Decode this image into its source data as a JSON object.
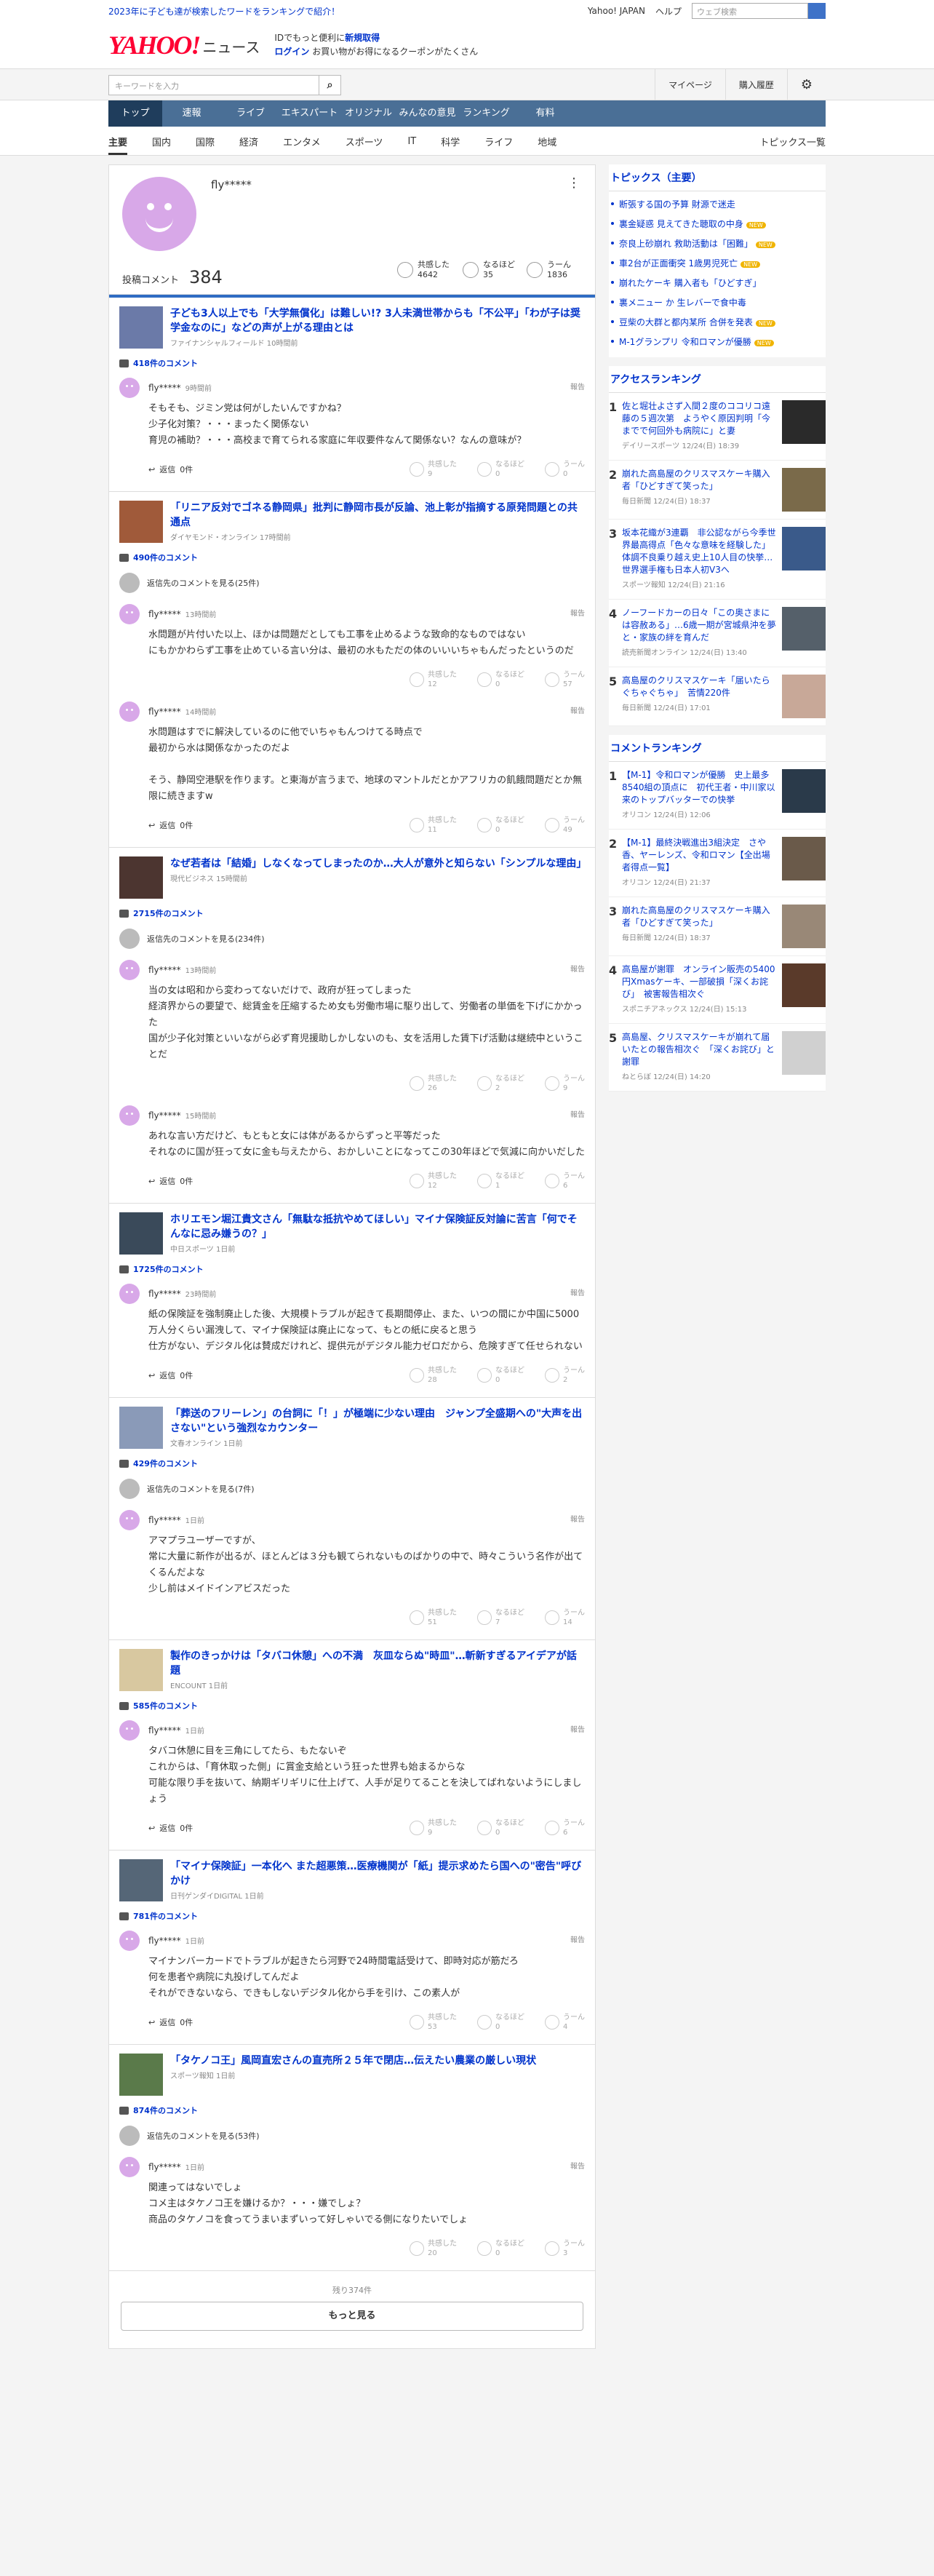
{
  "top": {
    "promo": "2023年に子ども達が検索したワードをランキングで紹介！",
    "yj": "Yahoo! JAPAN",
    "help": "ヘルプ",
    "search_ph": "ウェブ検索"
  },
  "brand": {
    "yahoo": "YAHOO!",
    "japan": "JAPAN",
    "news": "ニュース",
    "line1": "IDでもっと便利に",
    "signup": "新規取得",
    "login": "ログイン",
    "coupon": "お買い物がお得になるクーポンがたくさん"
  },
  "search": {
    "placeholder": "キーワードを入力",
    "mypage": "マイページ",
    "history": "購入履歴"
  },
  "nav": [
    "トップ",
    "速報",
    "ライブ",
    "エキスパート",
    "オリジナル",
    "みんなの意見",
    "ランキング",
    "有料"
  ],
  "sub": [
    "主要",
    "国内",
    "国際",
    "経済",
    "エンタメ",
    "スポーツ",
    "IT",
    "科学",
    "ライフ",
    "地域"
  ],
  "sub_right": "トピックス一覧",
  "profile": {
    "name": "fly*****",
    "count_label": "投稿コメント",
    "count": "384",
    "stats": [
      {
        "l": "共感した",
        "v": "4642"
      },
      {
        "l": "なるほど",
        "v": "35"
      },
      {
        "l": "うーん",
        "v": "1836"
      }
    ]
  },
  "articles": [
    {
      "title": "子ども3人以上でも「大学無償化」は難しい!? 3人未満世帯からも「不公平」「わが子は奨学金なのに」などの声が上がる理由とは",
      "src": "ファイナンシャルフィールド 10時間前",
      "cc": "418件のコメント",
      "reply": "",
      "comments": [
        {
          "u": "fly*****",
          "t": "9時間前",
          "text": "そもそも、ジミン党は何がしたいんですかね？\n少子化対策？・・・まったく関係ない\n育児の補助？・・・高校まで育てられる家庭に年収要件なんて関係ない？なんの意味が？",
          "r": "0件",
          "s": [
            "9",
            "0",
            "0"
          ]
        }
      ]
    },
    {
      "title": "「リニア反対でゴネる静岡県」批判に静岡市長が反論、池上彰が指摘する原発問題との共通点",
      "src": "ダイヤモンド・オンライン 17時間前",
      "cc": "490件のコメント",
      "reply": "返信先のコメントを見る(25件)",
      "comments": [
        {
          "u": "fly*****",
          "t": "13時間前",
          "text": "水問題が片付いた以上、ほかは問題だとしても工事を止めるような致命的なものではない\nにもかかわらず工事を止めている言い分は、最初の水もただの体のいいいちゃもんだったというのだ",
          "r": "",
          "s": [
            "12",
            "0",
            "57"
          ]
        },
        {
          "u": "fly*****",
          "t": "14時間前",
          "text": "水問題はすでに解決しているのに他でいちゃもんつけてる時点で\n最初から水は関係なかったのだよ\n\nそう、静岡空港駅を作ります。と東海が言うまで、地球のマントルだとかアフリカの飢餓問題だとか無限に続きますw",
          "r": "0件",
          "s": [
            "11",
            "0",
            "49"
          ]
        }
      ]
    },
    {
      "title": "なぜ若者は「結婚」しなくなってしまったのか…大人が意外と知らない「シンプルな理由」",
      "src": "現代ビジネス 15時間前",
      "cc": "2715件のコメント",
      "reply": "返信先のコメントを見る(234件)",
      "comments": [
        {
          "u": "fly*****",
          "t": "13時間前",
          "text": "当の女は昭和から変わってないだけで、政府が狂ってしまった\n経済界からの要望で、総賃金を圧縮するため女も労働市場に駆り出して、労働者の単価を下げにかかった\n国が少子化対策といいながら必ず育児援助しかしないのも、女を活用した賃下げ活動は継続中ということだ",
          "r": "",
          "s": [
            "26",
            "2",
            "9"
          ]
        },
        {
          "u": "fly*****",
          "t": "15時間前",
          "text": "あれな言い方だけど、もともと女には体があるからずっと平等だった\nそれなのに国が狂って女に金も与えたから、おかしいことになってこの30年ほどで気減に向かいだした",
          "r": "0件",
          "s": [
            "12",
            "1",
            "6"
          ]
        }
      ]
    },
    {
      "title": "ホリエモン堀江貴文さん「無駄な抵抗やめてほしい」マイナ保険証反対論に苦言「何でそんなに忌み嫌うの？」",
      "src": "中日スポーツ 1日前",
      "cc": "1725件のコメント",
      "reply": "",
      "comments": [
        {
          "u": "fly*****",
          "t": "23時間前",
          "text": "紙の保険証を強制廃止した後、大規模トラブルが起きて長期間停止、また、いつの間にか中国に5000万人分くらい漏洩して、マイナ保険証は廃止になって、もとの紙に戻ると思う\n仕方がない、デジタル化は賛成だけれど、提供元がデジタル能力ゼロだから、危険すぎて任せられない",
          "r": "0件",
          "s": [
            "28",
            "0",
            "2"
          ]
        }
      ]
    },
    {
      "title": "「葬送のフリーレン」の台詞に「！」が極端に少ない理由　ジャンプ全盛期への\"大声を出さない\"という強烈なカウンター",
      "src": "文春オンライン 1日前",
      "cc": "429件のコメント",
      "reply": "返信先のコメントを見る(7件)",
      "comments": [
        {
          "u": "fly*****",
          "t": "1日前",
          "text": "アマプラユーザーですが、\n常に大量に新作が出るが、ほとんどは３分も観てられないものばかりの中で、時々こういう名作が出てくるんだよな\n少し前はメイドインアビスだった",
          "r": "",
          "s": [
            "51",
            "7",
            "14"
          ]
        }
      ]
    },
    {
      "title": "製作のきっかけは「タバコ休憩」への不満　灰皿ならぬ\"時皿\"…斬新すぎるアイデアが話題",
      "src": "ENCOUNT 1日前",
      "cc": "585件のコメント",
      "reply": "",
      "comments": [
        {
          "u": "fly*****",
          "t": "1日前",
          "text": "タバコ休憩に目を三角にしてたら、もたないぞ\nこれからは、「育休取った側」に賞金支給という狂った世界も始まるからな\n可能な限り手を抜いて、納期ギリギリに仕上げて、人手が足りてることを決してばれないようにしましょう",
          "r": "0件",
          "s": [
            "9",
            "0",
            "6"
          ]
        }
      ]
    },
    {
      "title": "「マイナ保険証」一本化へ また超悪策…医療機関が「紙」提示求めたら国への\"密告\"呼びかけ",
      "src": "日刊ゲンダイDIGITAL 1日前",
      "cc": "781件のコメント",
      "reply": "",
      "comments": [
        {
          "u": "fly*****",
          "t": "1日前",
          "text": "マイナンバーカードでトラブルが起きたら河野で24時間電話受けて、即時対応が筋だろ\n何を患者や病院に丸投げしてんだよ\nそれができないなら、できもしないデジタル化から手を引け、この素人が",
          "r": "0件",
          "s": [
            "53",
            "0",
            "4"
          ]
        }
      ]
    },
    {
      "title": "「タケノコ王」風岡直宏さんの直売所２５年で閉店…伝えたい農業の厳しい現状",
      "src": "スポーツ報知 1日前",
      "cc": "874件のコメント",
      "reply": "返信先のコメントを見る(53件)",
      "comments": [
        {
          "u": "fly*****",
          "t": "1日前",
          "text": "関連ってはないでしょ\nコメ主はタケノコ王を嫌けるか？・・・嫌でしょ？\n商品のタケノコを食ってうまいまずいって好しゃいでる側になりたいでしょ",
          "r": "",
          "s": [
            "20",
            "0",
            "3"
          ]
        }
      ]
    }
  ],
  "more": {
    "remain": "残り374件",
    "label": "もっと見る"
  },
  "topics": {
    "title": "トピックス（主要）",
    "items": [
      {
        "t": "断張する国の予算 財源で迷走",
        "n": false
      },
      {
        "t": "裏金疑惑 見えてきた聴取の中身",
        "n": true
      },
      {
        "t": "奈良上砂崩れ 救助活動は「困難」",
        "n": true
      },
      {
        "t": "車2台が正面衝突 1歳男児死亡",
        "n": true
      },
      {
        "t": "崩れたケーキ 購入者も「ひどすぎ」",
        "n": false
      },
      {
        "t": "裏メニュー か 生レバーで食中毒",
        "n": false
      },
      {
        "t": "豆柴の大群と都内某所 合併を発表",
        "n": true
      },
      {
        "t": "M-1グランプリ 令和ロマンが優勝",
        "n": true
      }
    ],
    "new": "NEW"
  },
  "access": {
    "title": "アクセスランキング",
    "items": [
      {
        "n": "1",
        "t": "佐と堀壮よさず入間２度のココリコ遠藤の５週次第　ようやく原因判明「今までで何回外も病院に」と妻",
        "s": "デイリースポーツ 12/24(日) 18:39"
      },
      {
        "n": "2",
        "t": "崩れた高島屋のクリスマスケーキ購入者「ひどすぎて笑った」",
        "s": "毎日新聞 12/24(日) 18:37"
      },
      {
        "n": "3",
        "t": "坂本花織が3連覇　非公認ながら今季世界最高得点「色々な意味を経験した」体調不良乗り越え史上10人目の快挙…世界選手権も日本人初V3へ",
        "s": "スポーツ報知 12/24(日) 21:16"
      },
      {
        "n": "4",
        "t": "ノーフードカーの日々「この奥さまには容赦ある」…6歳一期が宮城県沖を夢と・家族の絆を育んだ",
        "s": "読売新聞オンライン 12/24(日) 13:40"
      },
      {
        "n": "5",
        "t": "高島屋のクリスマスケーキ「届いたらぐちゃぐちゃ」　苦情220件",
        "s": "毎日新聞 12/24(日) 17:01"
      }
    ]
  },
  "comment_rank": {
    "title": "コメントランキング",
    "items": [
      {
        "n": "1",
        "t": "【M-1】令和ロマンが優勝　史上最多8540組の頂点に　初代王者・中川家以来のトップバッターでの快挙",
        "s": "オリコン 12/24(日) 12:06"
      },
      {
        "n": "2",
        "t": "【M-1】最終決戦進出3組決定　さや香、ヤーレンズ、令和ロマン【全出場者得点一覧】",
        "s": "オリコン 12/24(日) 21:37"
      },
      {
        "n": "3",
        "t": "崩れた高島屋のクリスマスケーキ購入者「ひどすぎて笑った」",
        "s": "毎日新聞 12/24(日) 18:37"
      },
      {
        "n": "4",
        "t": "高島屋が謝罪　オンライン販売の5400円Xmasケーキ、一部破損「深くお詫び」　被害報告相次ぐ",
        "s": "スポニチアネックス 12/24(日) 15:13"
      },
      {
        "n": "5",
        "t": "高島屋、クリスマスケーキが崩れて届いたとの報告相次ぐ　「深くお詫び」と謝罪",
        "s": "ねとらぼ 12/24(日) 14:20"
      }
    ]
  }
}
